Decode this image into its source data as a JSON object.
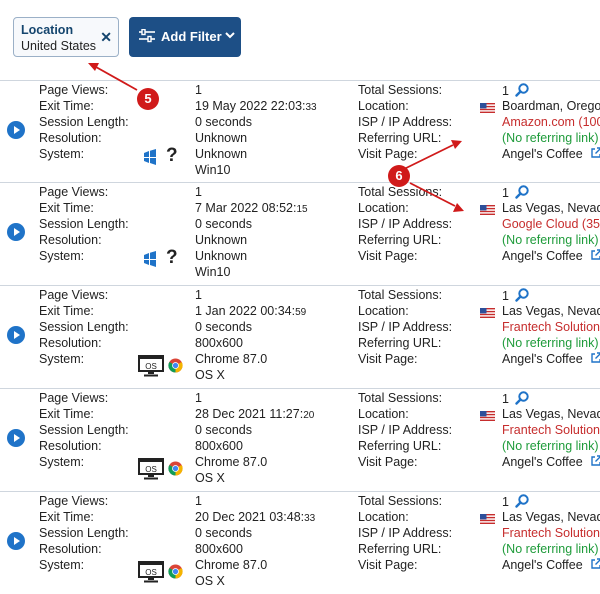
{
  "filter": {
    "chip_title": "Location",
    "chip_value": "United States",
    "add_label": "Add Filter"
  },
  "labels": {
    "page_views": "Page Views:",
    "exit_time": "Exit Time:",
    "session_length": "Session Length:",
    "resolution": "Resolution:",
    "system": "System:",
    "total_sessions": "Total Sessions:",
    "location": "Location:",
    "isp": "ISP / IP Address:",
    "referring": "Referring URL:",
    "visit_page": "Visit Page:"
  },
  "icons": {
    "play": "play-icon",
    "search": "search-icon",
    "external": "external-link-icon",
    "flag": "us-flag-icon"
  },
  "colors": {
    "accent": "#1d4f86",
    "isp_red": "#c62d2d",
    "referrer_green": "#1e9b3a",
    "annotation_red": "#d01a1a"
  },
  "annotations": [
    "5",
    "6"
  ],
  "rows": [
    {
      "page_views": "1",
      "exit_date": "19 May 2022 22:03:",
      "exit_sec": "33",
      "session_length": "0 seconds",
      "resolution": "Unknown",
      "browser": "Unknown",
      "os": "Win10",
      "total_sessions": "1",
      "location": "Boardman, Orego",
      "isp": "Amazon.com (100",
      "referring": "(No referring link)",
      "visit_page": "Angel's Coffee",
      "system_icon": "windows-icon",
      "browser_icon": "unknown-question-icon"
    },
    {
      "page_views": "1",
      "exit_date": "7 Mar 2022 08:52:",
      "exit_sec": "15",
      "session_length": "0 seconds",
      "resolution": "Unknown",
      "browser": "Unknown",
      "os": "Win10",
      "total_sessions": "1",
      "location": "Las Vegas, Nevada",
      "isp": "Google Cloud (35.",
      "referring": "(No referring link)",
      "visit_page": "Angel's Coffee",
      "system_icon": "windows-icon",
      "browser_icon": "unknown-question-icon"
    },
    {
      "page_views": "1",
      "exit_date": "1 Jan 2022 00:34:",
      "exit_sec": "59",
      "session_length": "0 seconds",
      "resolution": "800x600",
      "browser": "Chrome 87.0",
      "os": "OS X",
      "total_sessions": "1",
      "location": "Las Vegas, Nevada",
      "isp": "Frantech Solution",
      "referring": "(No referring link)",
      "visit_page": "Angel's Coffee",
      "system_icon": "mac-os-monitor-icon",
      "browser_icon": "chrome-icon"
    },
    {
      "page_views": "1",
      "exit_date": "28 Dec 2021 11:27:",
      "exit_sec": "20",
      "session_length": "0 seconds",
      "resolution": "800x600",
      "browser": "Chrome 87.0",
      "os": "OS X",
      "total_sessions": "1",
      "location": "Las Vegas, Nevada",
      "isp": "Frantech Solution",
      "referring": "(No referring link)",
      "visit_page": "Angel's Coffee",
      "system_icon": "mac-os-monitor-icon",
      "browser_icon": "chrome-icon"
    },
    {
      "page_views": "1",
      "exit_date": "20 Dec 2021 03:48:",
      "exit_sec": "33",
      "session_length": "0 seconds",
      "resolution": "800x600",
      "browser": "Chrome 87.0",
      "os": "OS X",
      "total_sessions": "1",
      "location": "Las Vegas, Nevada",
      "isp": "Frantech Solution",
      "referring": "(No referring link)",
      "visit_page": "Angel's Coffee",
      "system_icon": "mac-os-monitor-icon",
      "browser_icon": "chrome-icon"
    }
  ]
}
